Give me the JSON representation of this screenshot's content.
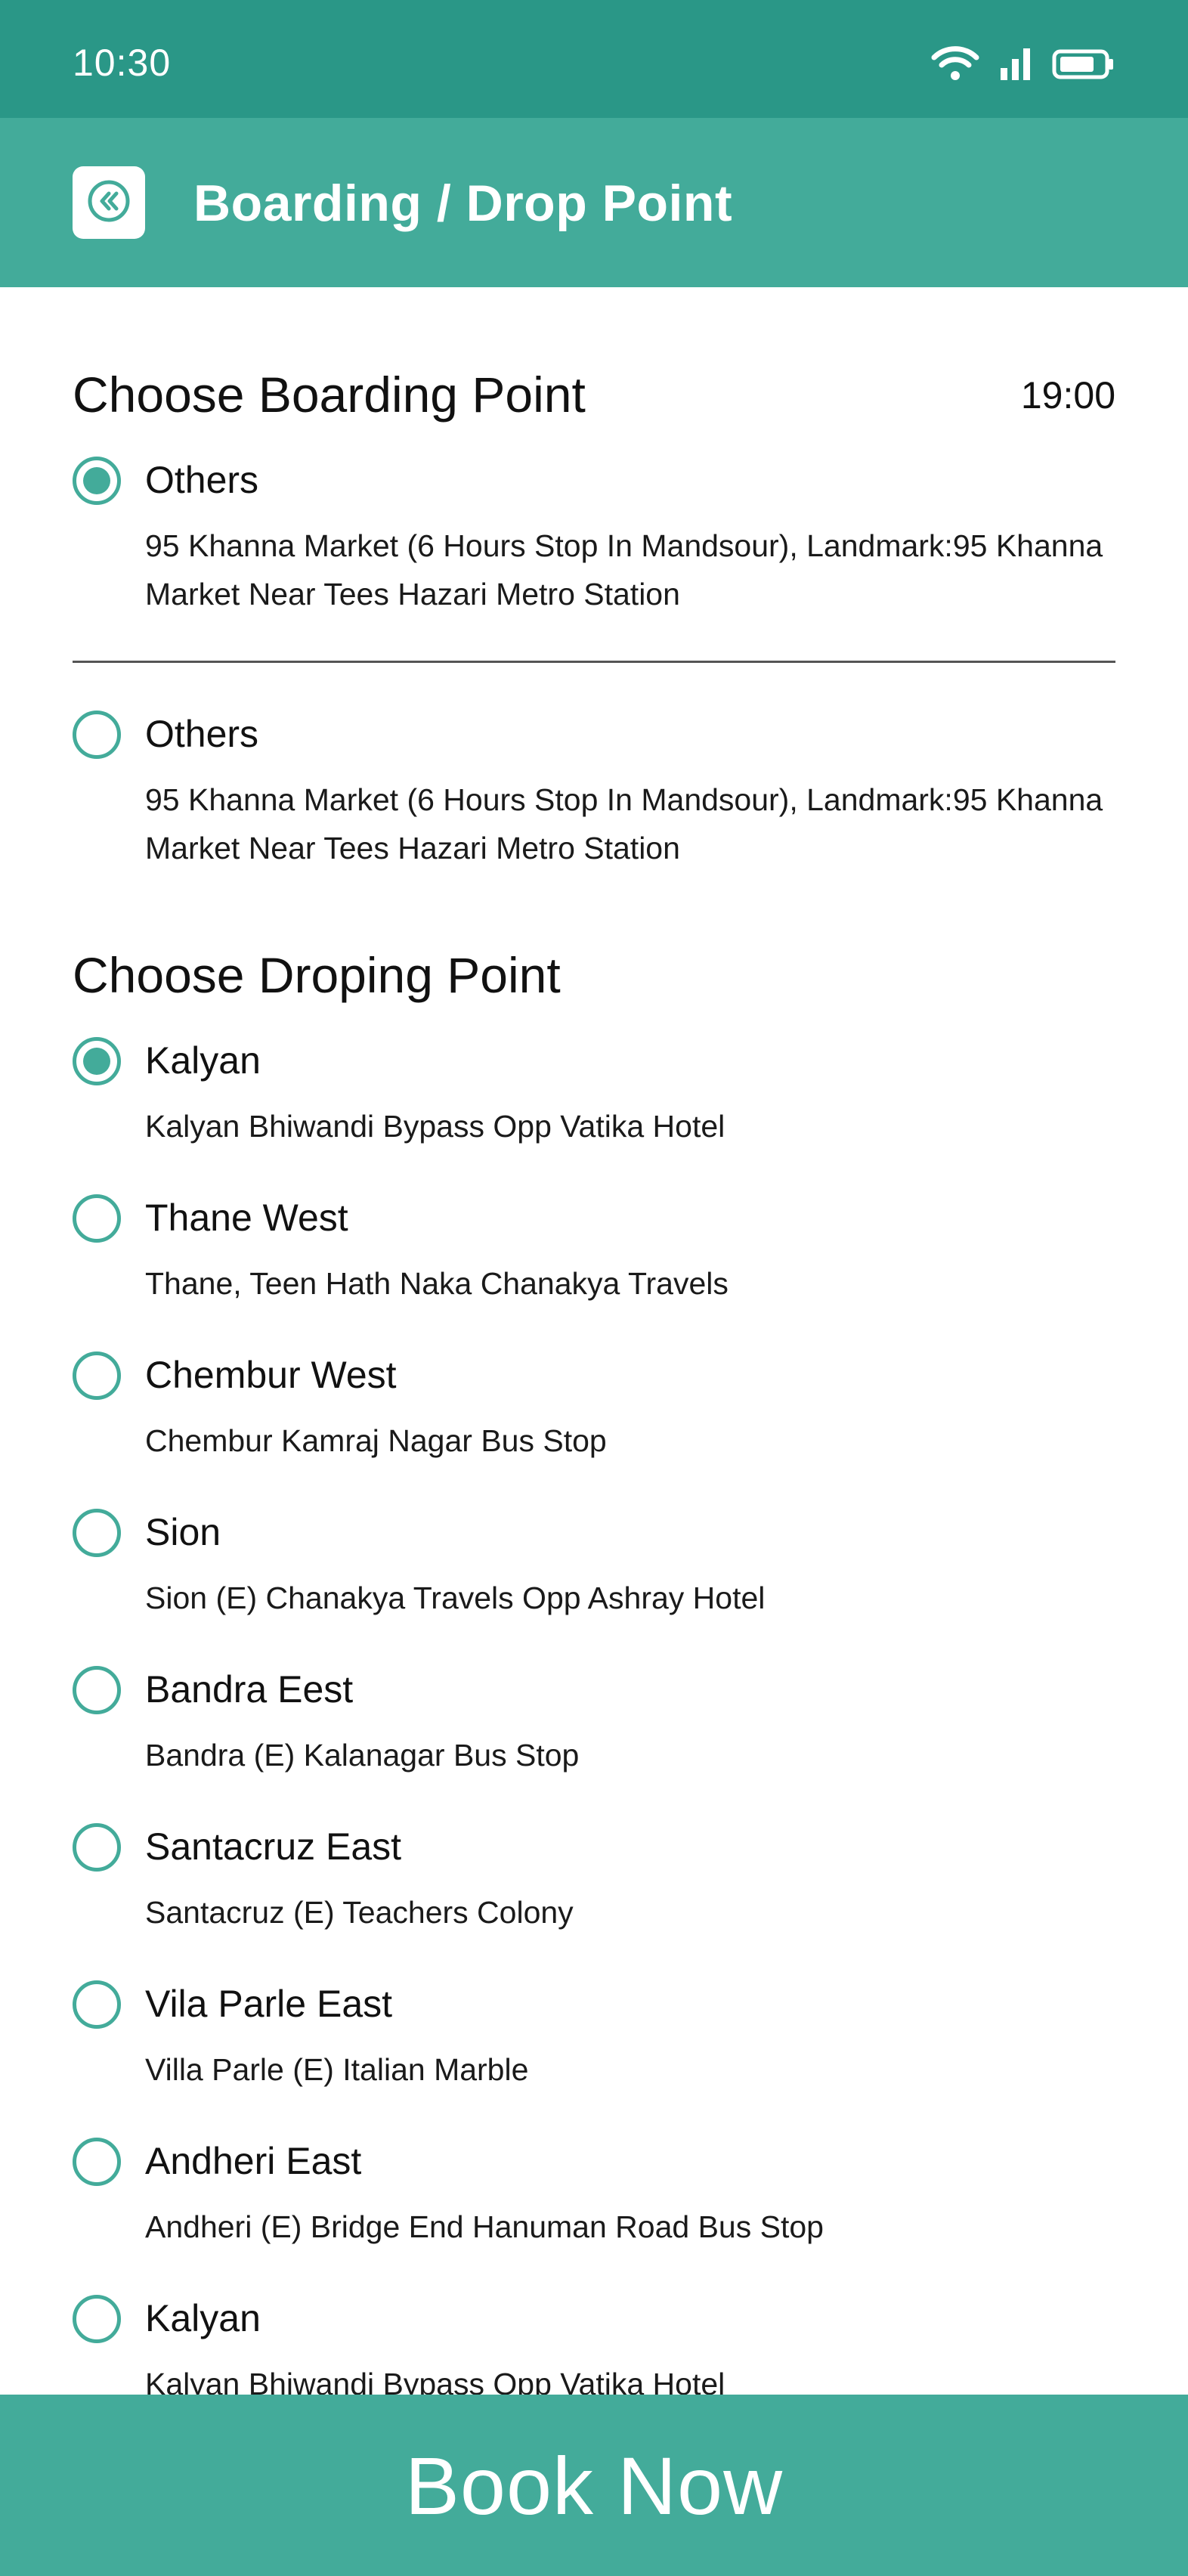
{
  "status_bar": {
    "time": "10:30",
    "icons": [
      "wifi-icon",
      "signal-icon",
      "battery-icon"
    ]
  },
  "app_bar": {
    "back_icon": "double-chevron-left-icon",
    "title": "Boarding / Drop Point"
  },
  "boarding": {
    "title": "Choose Boarding Point",
    "time": "19:00",
    "options": [
      {
        "name": "Others",
        "address": "95 Khanna Market (6 Hours Stop In Mandsour), Landmark:95 Khanna Market Near Tees Hazari Metro Station",
        "selected": true
      },
      {
        "name": "Others",
        "address": "95 Khanna Market (6 Hours Stop In Mandsour), Landmark:95 Khanna Market Near Tees Hazari Metro Station",
        "selected": false
      }
    ]
  },
  "dropping": {
    "title": "Choose Droping Point",
    "options": [
      {
        "name": "Kalyan",
        "address": "Kalyan Bhiwandi Bypass Opp Vatika Hotel",
        "selected": true
      },
      {
        "name": "Thane West",
        "address": "Thane, Teen Hath Naka Chanakya Travels",
        "selected": false
      },
      {
        "name": "Chembur West",
        "address": "Chembur Kamraj Nagar Bus Stop",
        "selected": false
      },
      {
        "name": "Sion",
        "address": "Sion (E) Chanakya Travels Opp Ashray Hotel",
        "selected": false
      },
      {
        "name": "Bandra Eest",
        "address": "Bandra (E) Kalanagar Bus Stop",
        "selected": false
      },
      {
        "name": "Santacruz East",
        "address": "Santacruz (E) Teachers Colony",
        "selected": false
      },
      {
        "name": "Vila Parle East",
        "address": "Villa Parle (E) Italian Marble",
        "selected": false
      },
      {
        "name": "Andheri East",
        "address": "Andheri (E) Bridge End Hanuman Road Bus Stop",
        "selected": false
      },
      {
        "name": "Kalyan",
        "address": "Kalyan Bhiwandi Bypass Opp Vatika Hotel",
        "selected": false
      }
    ]
  },
  "footer": {
    "book_label": "Book Now"
  },
  "colors": {
    "status_bar": "#2a9787",
    "accent": "#43ab9a",
    "text": "#111111"
  }
}
